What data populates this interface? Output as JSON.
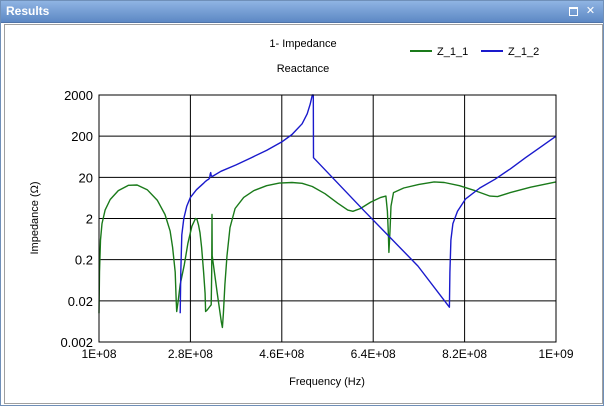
{
  "window": {
    "title": "Results"
  },
  "chart_data": {
    "type": "line",
    "title": "1- Impedance",
    "subtitle": "Reactance",
    "xlabel": "Frequency (Hz)",
    "ylabel": "Impedance (Ω)",
    "y_scale": "log",
    "xlim": [
      100000000,
      1000000000
    ],
    "ylim": [
      0.002,
      2000
    ],
    "x_ticks": [
      {
        "value": 100000000,
        "label": "1E+08"
      },
      {
        "value": 280000000,
        "label": "2.8E+08"
      },
      {
        "value": 460000000,
        "label": "4.6E+08"
      },
      {
        "value": 640000000,
        "label": "6.4E+08"
      },
      {
        "value": 820000000,
        "label": "8.2E+08"
      },
      {
        "value": 1000000000,
        "label": "1E+09"
      }
    ],
    "y_ticks": [
      {
        "value": 2000,
        "label": "2000"
      },
      {
        "value": 200,
        "label": "200"
      },
      {
        "value": 20,
        "label": "20"
      },
      {
        "value": 2,
        "label": "2"
      },
      {
        "value": 0.2,
        "label": "0.2"
      },
      {
        "value": 0.02,
        "label": "0.02"
      },
      {
        "value": 0.002,
        "label": "0.002"
      }
    ],
    "grid": true,
    "legend_position": "top-right",
    "series": [
      {
        "name": "Z_1_1",
        "color": "#1a7a1a",
        "points": [
          [
            100000000,
            0.01
          ],
          [
            101000000,
            0.1
          ],
          [
            103000000,
            0.6
          ],
          [
            106000000,
            1.5
          ],
          [
            112000000,
            3.2
          ],
          [
            122000000,
            5.8
          ],
          [
            138000000,
            9.5
          ],
          [
            158000000,
            12.8
          ],
          [
            175000000,
            13.0
          ],
          [
            195000000,
            10.0
          ],
          [
            215000000,
            5.5
          ],
          [
            230000000,
            2.5
          ],
          [
            240000000,
            1.0
          ],
          [
            245000000,
            0.4
          ],
          [
            250000000,
            0.1
          ],
          [
            252000000,
            0.02
          ],
          [
            253000000,
            0.011
          ],
          [
            256000000,
            0.02
          ],
          [
            260000000,
            0.05
          ],
          [
            268000000,
            0.15
          ],
          [
            275000000,
            0.5
          ],
          [
            283000000,
            1.3
          ],
          [
            290000000,
            2.0
          ],
          [
            293000000,
            1.9
          ],
          [
            296000000,
            1.4
          ],
          [
            299000000,
            0.9
          ],
          [
            302000000,
            0.4
          ],
          [
            306000000,
            0.1
          ],
          [
            309000000,
            0.03
          ],
          [
            310000000,
            0.011
          ],
          [
            313000000,
            0.012
          ],
          [
            319000000,
            0.015
          ],
          [
            321000000,
            0.016
          ],
          [
            322000000,
            0.1
          ],
          [
            322500000,
            2.5
          ],
          [
            323000000,
            0.25
          ],
          [
            333000000,
            0.03
          ],
          [
            341000000,
            0.006
          ],
          [
            343000000,
            0.0045
          ],
          [
            345000000,
            0.01
          ],
          [
            348000000,
            0.05
          ],
          [
            352000000,
            0.25
          ],
          [
            358000000,
            1.2
          ],
          [
            368000000,
            3.5
          ],
          [
            385000000,
            6.5
          ],
          [
            405000000,
            9.5
          ],
          [
            430000000,
            12.5
          ],
          [
            455000000,
            14.5
          ],
          [
            480000000,
            15.0
          ],
          [
            500000000,
            14.3
          ],
          [
            520000000,
            12.0
          ],
          [
            545000000,
            8.0
          ],
          [
            570000000,
            4.7
          ],
          [
            590000000,
            3.2
          ],
          [
            600000000,
            3.0
          ],
          [
            615000000,
            3.5
          ],
          [
            635000000,
            5.0
          ],
          [
            655000000,
            6.5
          ],
          [
            665000000,
            7.0
          ],
          [
            668000000,
            3.0
          ],
          [
            670000000,
            0.8
          ],
          [
            671000000,
            0.3
          ],
          [
            673000000,
            1.0
          ],
          [
            675000000,
            4.0
          ],
          [
            680000000,
            8.5
          ],
          [
            700000000,
            11.0
          ],
          [
            730000000,
            13.5
          ],
          [
            760000000,
            15.5
          ],
          [
            780000000,
            15.0
          ],
          [
            810000000,
            12.5
          ],
          [
            840000000,
            9.5
          ],
          [
            870000000,
            7.0
          ],
          [
            885000000,
            6.8
          ],
          [
            910000000,
            8.5
          ],
          [
            950000000,
            11.5
          ],
          [
            1000000000,
            15.5
          ]
        ]
      },
      {
        "name": "Z_1_2",
        "color": "#1a1acc",
        "points": [
          [
            260000000,
            0.01
          ],
          [
            261000000,
            0.1
          ],
          [
            263000000,
            0.8
          ],
          [
            267000000,
            2.0
          ],
          [
            273000000,
            4.0
          ],
          [
            280000000,
            6.5
          ],
          [
            292000000,
            10.0
          ],
          [
            305000000,
            14.0
          ],
          [
            310000000,
            16.0
          ],
          [
            314000000,
            17.5
          ],
          [
            316000000,
            18.0
          ],
          [
            318000000,
            19.5
          ],
          [
            319000000,
            24.0
          ],
          [
            320000000,
            26.0
          ],
          [
            321000000,
            22.0
          ],
          [
            323000000,
            21.0
          ],
          [
            340000000,
            28.0
          ],
          [
            370000000,
            40.0
          ],
          [
            400000000,
            60.0
          ],
          [
            430000000,
            90.0
          ],
          [
            460000000,
            145.0
          ],
          [
            480000000,
            220.0
          ],
          [
            500000000,
            400.0
          ],
          [
            510000000,
            700.0
          ],
          [
            516000000,
            1200.0
          ],
          [
            520000000,
            2000.0
          ],
          [
            522000000,
            3000.0
          ],
          [
            522500000,
            60.0
          ],
          [
            623000000,
            3.0
          ],
          [
            728000000,
            0.14
          ],
          [
            790000000,
            0.014
          ],
          [
            791000000,
            0.1
          ],
          [
            793000000,
            0.6
          ],
          [
            797000000,
            1.5
          ],
          [
            806000000,
            3.0
          ],
          [
            822000000,
            6.0
          ],
          [
            850000000,
            11.0
          ],
          [
            880000000,
            18.0
          ],
          [
            910000000,
            32.0
          ],
          [
            940000000,
            60.0
          ],
          [
            970000000,
            110.0
          ],
          [
            1000000000,
            200.0
          ]
        ]
      }
    ]
  }
}
